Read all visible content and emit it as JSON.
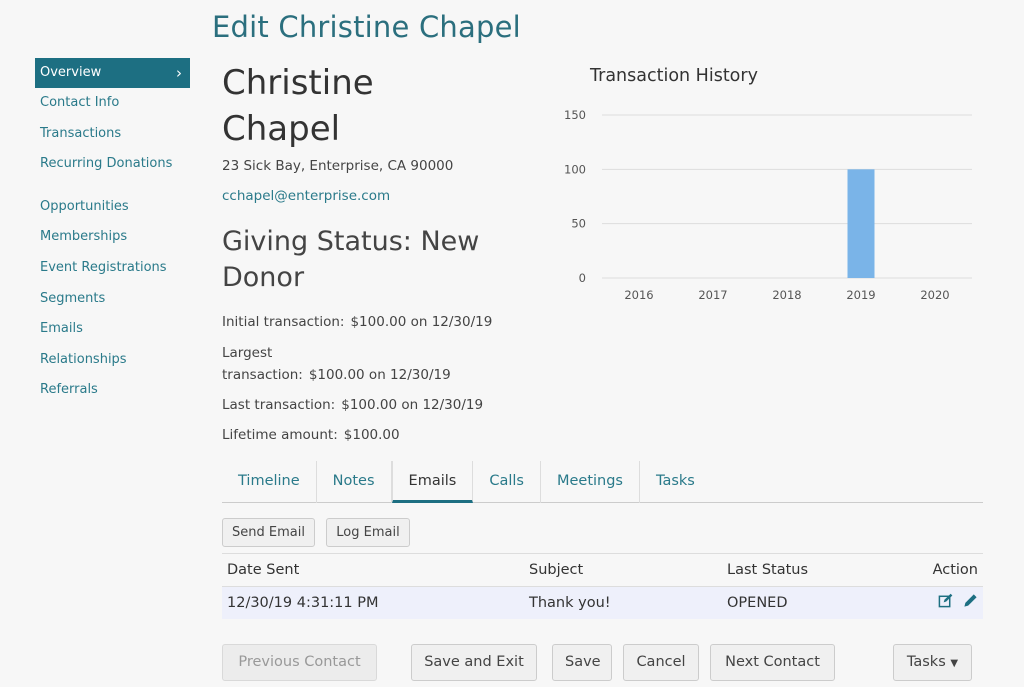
{
  "page_title": "Edit Christine Chapel",
  "sidebar": {
    "items": [
      {
        "label": "Overview",
        "active": true
      },
      {
        "label": "Contact Info"
      },
      {
        "label": "Transactions"
      },
      {
        "label": "Recurring Donations"
      },
      {
        "label": "Opportunities"
      },
      {
        "label": "Memberships"
      },
      {
        "label": "Event Registrations"
      },
      {
        "label": "Segments"
      },
      {
        "label": "Emails"
      },
      {
        "label": "Relationships"
      },
      {
        "label": "Referrals"
      }
    ]
  },
  "contact": {
    "name": "Christine Chapel",
    "address": "23 Sick Bay, Enterprise, CA 90000",
    "email": "cchapel@enterprise.com",
    "giving_status": "Giving Status: New Donor",
    "initial_label": "Initial transaction:",
    "initial_value": "$100.00 on 12/30/19",
    "largest_label_1": "Largest",
    "largest_label_2": "transaction:",
    "largest_value": "$100.00 on 12/30/19",
    "last_label": "Last transaction:",
    "last_value": "$100.00 on 12/30/19",
    "lifetime_label": "Lifetime amount:",
    "lifetime_value": "$100.00"
  },
  "chart_data": {
    "type": "bar",
    "title": "Transaction History",
    "categories": [
      "2016",
      "2017",
      "2018",
      "2019",
      "2020"
    ],
    "values": [
      0,
      0,
      0,
      100,
      0
    ],
    "yticks": [
      0,
      50,
      100,
      150
    ],
    "ylim": [
      0,
      150
    ],
    "grid": true,
    "bar_color": "#7ab4e8"
  },
  "tabs": [
    "Timeline",
    "Notes",
    "Emails",
    "Calls",
    "Meetings",
    "Tasks"
  ],
  "active_tab": "Emails",
  "email_buttons": {
    "send": "Send Email",
    "log": "Log Email"
  },
  "email_table": {
    "headers": {
      "date": "Date Sent",
      "subject": "Subject",
      "status": "Last Status",
      "action": "Action"
    },
    "rows": [
      {
        "date": "12/30/19 4:31:11 PM",
        "subject": "Thank you!",
        "status": "OPENED"
      }
    ]
  },
  "footer": {
    "previous": "Previous Contact",
    "save_exit": "Save and Exit",
    "save": "Save",
    "cancel": "Cancel",
    "next": "Next Contact",
    "tasks": "Tasks"
  },
  "colors": {
    "accent": "#1d6f82",
    "link": "#2a7a8a",
    "title": "#2b6f7e"
  }
}
